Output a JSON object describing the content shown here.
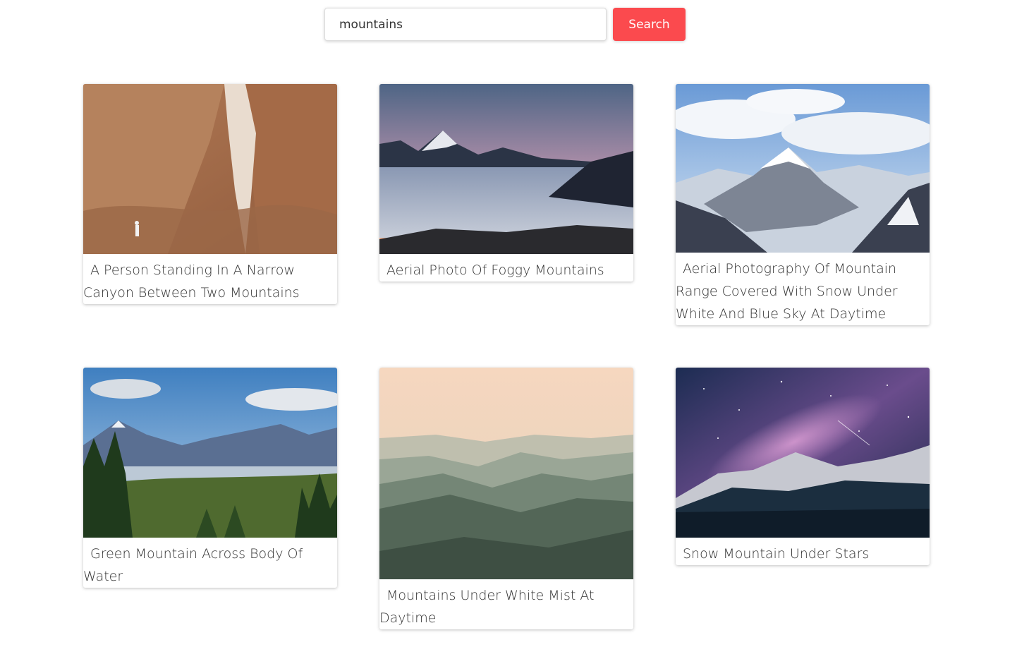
{
  "search": {
    "value": "mountains",
    "button_label": "Search"
  },
  "colors": {
    "accent": "#fb4a4e"
  },
  "results": [
    {
      "caption": "A Person Standing In A Narrow Canyon Between Two Mountains",
      "photo": "canyon-photo"
    },
    {
      "caption": "Aerial Photo Of Foggy Mountains",
      "photo": "foggy-mountains-photo"
    },
    {
      "caption": "Aerial Photography Of Mountain Range Covered With Snow Under White And Blue Sky At Daytime",
      "photo": "snowy-range-photo"
    },
    {
      "caption": "Green Mountain Across Body Of Water",
      "photo": "green-mountain-photo"
    },
    {
      "caption": "Mountains Under White Mist At Daytime",
      "photo": "misty-mountains-photo"
    },
    {
      "caption": "Snow Mountain Under Stars",
      "photo": "starry-mountain-photo"
    }
  ]
}
